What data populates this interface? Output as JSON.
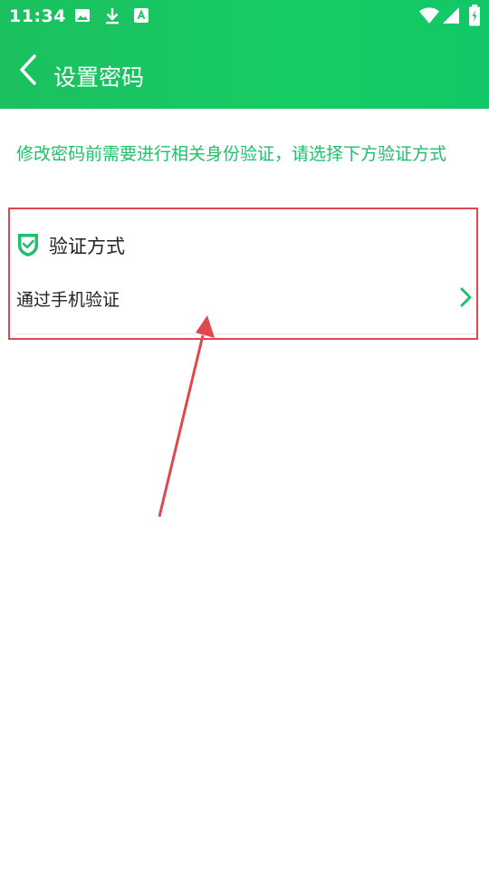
{
  "status_bar": {
    "time": "11:34",
    "icons": [
      "image-icon",
      "download-icon",
      "text-a-icon",
      "wifi-icon",
      "signal-icon",
      "battery-charging-icon"
    ]
  },
  "toolbar": {
    "title": "设置密码",
    "back_icon": "chevron-left-icon"
  },
  "hint": "修改密码前需要进行相关身份验证，请选择下方验证方式",
  "verification": {
    "section_title": "验证方式",
    "section_icon": "shield-check-icon",
    "options": [
      {
        "label": "通过手机验证",
        "icon": "chevron-right-icon"
      }
    ]
  },
  "colors": {
    "brand_green": "#16cc63",
    "accent_text_green": "#1fc06a",
    "annotation_red": "#e0474e"
  }
}
